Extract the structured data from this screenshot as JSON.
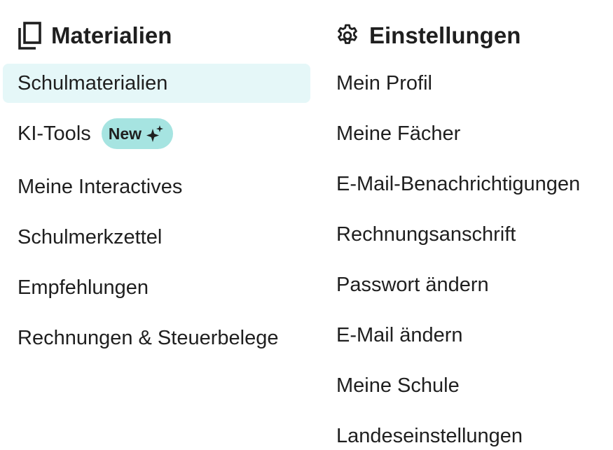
{
  "materials": {
    "title": "Materialien",
    "icon": "copy-pages-icon",
    "items": [
      {
        "label": "Schulmaterialien",
        "active": true
      },
      {
        "label": "KI-Tools",
        "badge": "New",
        "badge_icon": "sparkle-icon"
      },
      {
        "label": "Meine Interactives"
      },
      {
        "label": "Schulmerkzettel"
      },
      {
        "label": "Empfehlungen"
      },
      {
        "label": "Rechnungen & Steuerbelege"
      }
    ]
  },
  "settings": {
    "title": "Einstellungen",
    "icon": "gear-icon",
    "items": [
      {
        "label": "Mein Profil"
      },
      {
        "label": "Meine Fächer"
      },
      {
        "label": "E-Mail-Benachrichtigungen"
      },
      {
        "label": "Rechnungsanschrift"
      },
      {
        "label": "Passwort ändern"
      },
      {
        "label": "E-Mail ändern"
      },
      {
        "label": "Meine Schule"
      },
      {
        "label": "Landeseinstellungen"
      }
    ]
  },
  "colors": {
    "active_background": "#e5f7f8",
    "badge_background": "#a6e4e1",
    "text": "#1f1f1f"
  }
}
